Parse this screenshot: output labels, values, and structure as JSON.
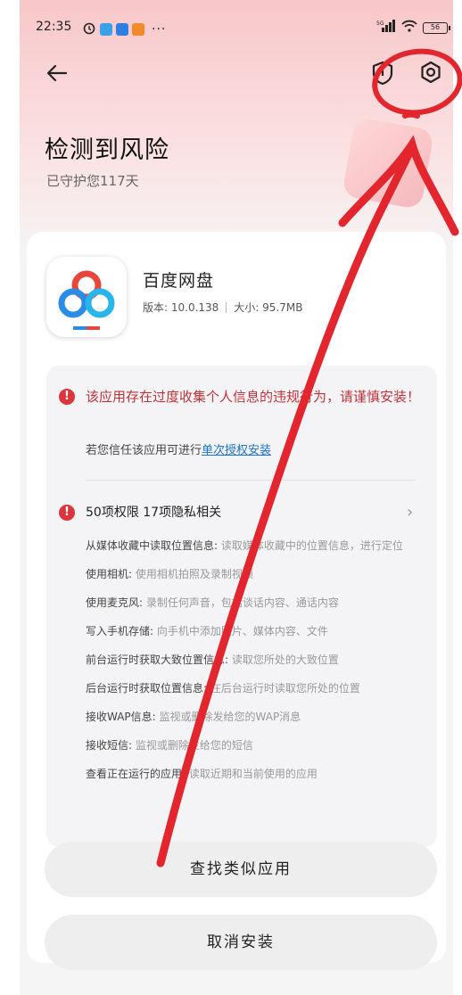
{
  "status_bar": {
    "time": "22:35",
    "dots": "···",
    "network": "5G",
    "battery": "56"
  },
  "header": {
    "title": "检测到风险",
    "subtitle": "已守护您117天"
  },
  "app": {
    "name": "百度网盘",
    "version": "版本: 10.0.138",
    "size": "大小: 95.7MB"
  },
  "risk": {
    "warning": "该应用存在过度收集个人信息的违规行为，请谨慎安装！",
    "trust_prefix": "若您信任该应用可进行",
    "trust_link": "单次授权安装",
    "permissions_summary": "50项权限 17项隐私相关",
    "permissions": [
      {
        "name": "从媒体收藏中读取位置信息:",
        "desc": "读取媒体收藏中的位置信息，进行定位"
      },
      {
        "name": "使用相机:",
        "desc": "使用相机拍照及录制视频"
      },
      {
        "name": "使用麦克风:",
        "desc": "录制任何声音，包括谈话内容、通话内容"
      },
      {
        "name": "写入手机存储:",
        "desc": "向手机中添加照片、媒体内容、文件"
      },
      {
        "name": "前台运行时获取大致位置信息:",
        "desc": "读取您所处的大致位置"
      },
      {
        "name": "后台运行时获取位置信息:",
        "desc": "在后台运行时读取您所处的位置"
      },
      {
        "name": "接收WAP信息:",
        "desc": "监视或删除发给您的WAP消息"
      },
      {
        "name": "接收短信:",
        "desc": "监视或删除发给您的短信"
      },
      {
        "name": "查看正在运行的应用:",
        "desc": "读取近期和当前使用的应用"
      }
    ]
  },
  "buttons": {
    "find_similar": "查找类似应用",
    "cancel_install": "取消安装"
  },
  "colors": {
    "accent_red": "#d9363e",
    "link_blue": "#1a73c9",
    "annotation_red": "#e3262d"
  }
}
